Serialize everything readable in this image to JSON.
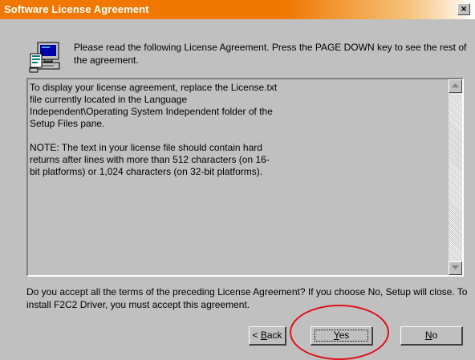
{
  "window": {
    "title": "Software License Agreement",
    "close_label": "×",
    "titlebar_color": "#f07800"
  },
  "header": {
    "icon": "setup-computer-icon",
    "instruction": "Please read the following License Agreement.  Press the PAGE DOWN key to see the rest of the agreement."
  },
  "license": {
    "text": "To display your license agreement, replace the License.txt file currently located in the Language Independent\\Operating System Independent folder of the Setup Files pane.\n\nNOTE: The text in your license file should contain hard returns after lines with more than 512 characters (on 16-bit platforms) or 1,024 characters (on 32-bit platforms).",
    "scroll_up_icon": "up-arrow-icon",
    "scroll_down_icon": "down-arrow-icon"
  },
  "question": {
    "text": "Do you accept all the terms of the preceding License Agreement?  If you choose No,  Setup will close.  To install F2C2 Driver, you must accept this agreement."
  },
  "buttons": {
    "back": {
      "prefix": "< ",
      "accel": "B",
      "rest": "ack"
    },
    "yes": {
      "accel": "Y",
      "rest": "es"
    },
    "no": {
      "accel": "N",
      "rest": "o"
    }
  },
  "annotation": {
    "color": "#e0101a",
    "target": "yes-button"
  }
}
